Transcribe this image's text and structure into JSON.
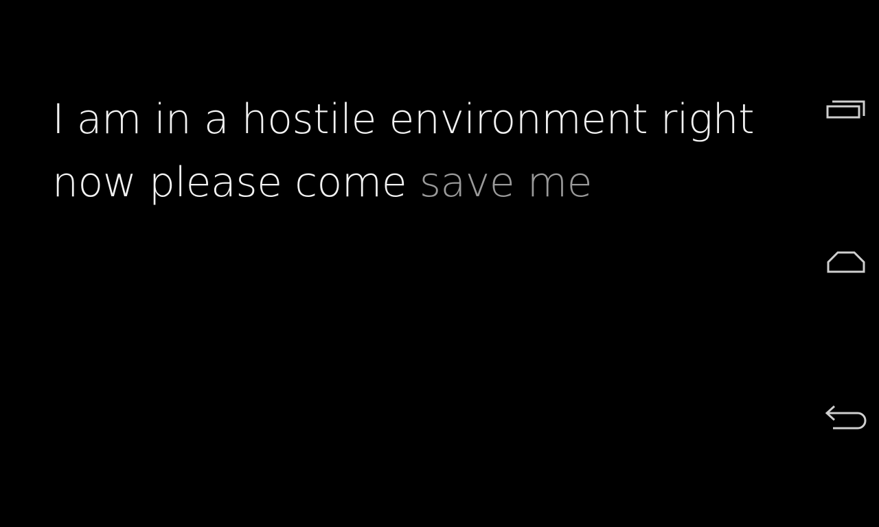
{
  "dictation": {
    "committed_text": "I am in a hostile environment right now please come",
    "pending_text": "save me"
  },
  "navigation": {
    "buttons": [
      {
        "name": "recents",
        "icon": "recent-apps-icon"
      },
      {
        "name": "home",
        "icon": "home-icon"
      },
      {
        "name": "back",
        "icon": "back-icon"
      }
    ]
  },
  "colors": {
    "background": "#000000",
    "committed_text": "#f2f2f2",
    "pending_text": "#9a9a9a",
    "nav_icon": "#cfcfcf"
  }
}
